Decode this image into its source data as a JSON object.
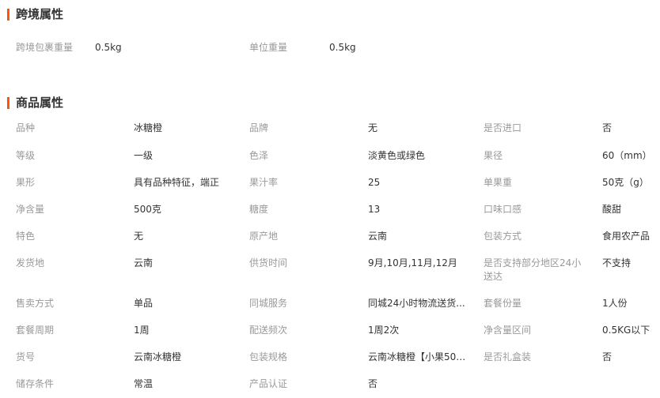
{
  "cross_border": {
    "title": "跨境属性",
    "items": [
      {
        "label": "跨境包裹重量",
        "value": "0.5kg"
      },
      {
        "label": "单位重量",
        "value": "0.5kg"
      }
    ]
  },
  "product": {
    "title": "商品属性",
    "rows": [
      [
        {
          "label": "品种",
          "value": "冰糖橙"
        },
        {
          "label": "品牌",
          "value": "无"
        },
        {
          "label": "是否进口",
          "value": "否"
        }
      ],
      [
        {
          "label": "等级",
          "value": "一级"
        },
        {
          "label": "色泽",
          "value": "淡黄色或绿色"
        },
        {
          "label": "果径",
          "value": "60（mm）"
        }
      ],
      [
        {
          "label": "果形",
          "value": "具有品种特征，端正"
        },
        {
          "label": "果汁率",
          "value": "25"
        },
        {
          "label": "单果重",
          "value": "50克（g）"
        }
      ],
      [
        {
          "label": "净含量",
          "value": "500克"
        },
        {
          "label": "糖度",
          "value": "13"
        },
        {
          "label": "口味口感",
          "value": "酸甜"
        }
      ],
      [
        {
          "label": "特色",
          "value": "无"
        },
        {
          "label": "原产地",
          "value": "云南"
        },
        {
          "label": "包装方式",
          "value": "食用农产品"
        }
      ],
      [
        {
          "label": "发货地",
          "value": "云南"
        },
        {
          "label": "供货时间",
          "value": "9月,10月,11月,12月"
        },
        {
          "label": "是否支持部分地区24小送达",
          "value": "不支持"
        }
      ],
      [
        {
          "label": "售卖方式",
          "value": "单品"
        },
        {
          "label": "同城服务",
          "value": "同城24小时物流送货..."
        },
        {
          "label": "套餐份量",
          "value": "1人份"
        }
      ],
      [
        {
          "label": "套餐周期",
          "value": "1周"
        },
        {
          "label": "配送频次",
          "value": "1周2次"
        },
        {
          "label": "净含量区间",
          "value": "0.5KG以下"
        }
      ],
      [
        {
          "label": "货号",
          "value": "云南冰糖橙"
        },
        {
          "label": "包装规格",
          "value": "云南冰糖橙【小果50-..."
        },
        {
          "label": "是否礼盒装",
          "value": "否"
        }
      ],
      [
        {
          "label": "储存条件",
          "value": "常温"
        },
        {
          "label": "产品认证",
          "value": "否"
        }
      ]
    ]
  }
}
